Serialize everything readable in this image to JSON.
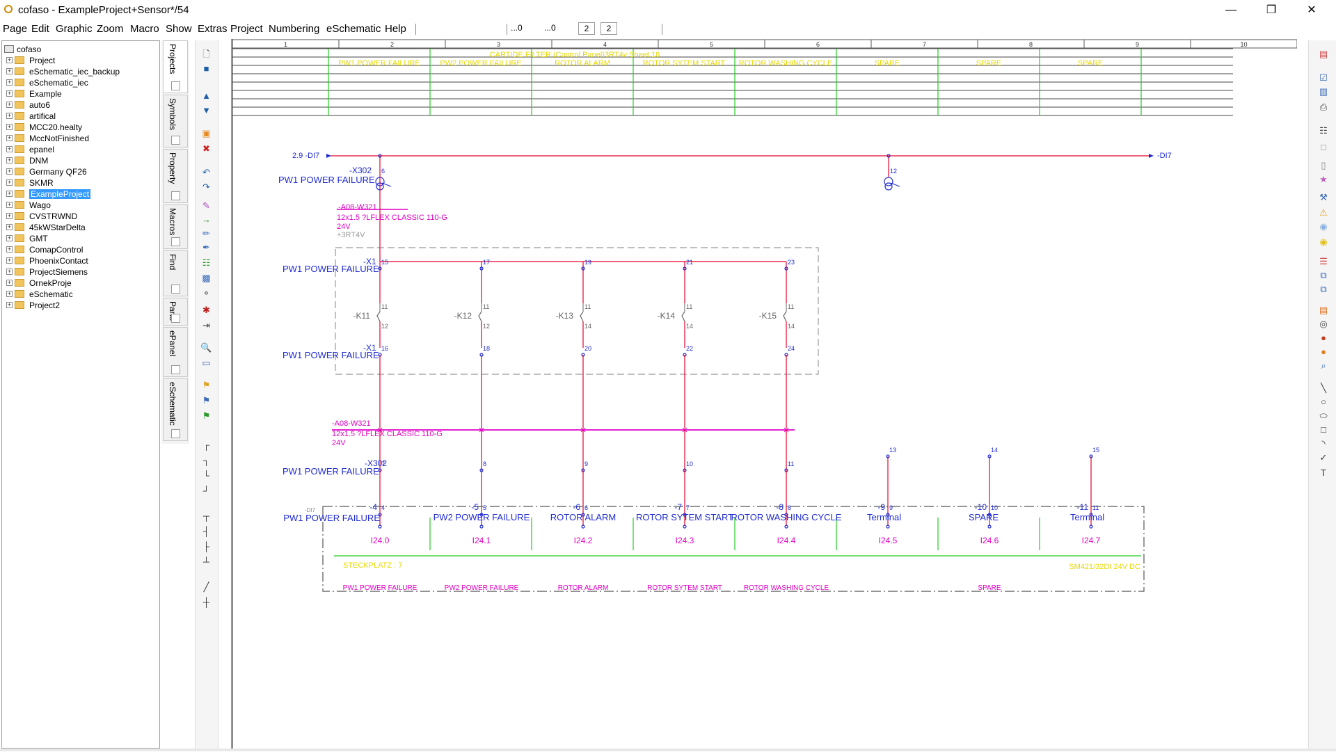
{
  "window": {
    "title": "cofaso - ExampleProject+Sensor*/54"
  },
  "menu": {
    "items": [
      "Page",
      "Edit",
      "Graphic",
      "Zoom",
      "Macro",
      "Show",
      "Extras",
      "Project",
      "Numbering",
      "eSchematic",
      "Help"
    ],
    "field_a": "...0",
    "field_b": "...0",
    "page_box_1": "2",
    "page_box_2": "2"
  },
  "tree": {
    "root": "cofaso",
    "items": [
      "Project",
      "eSchematic_iec_backup",
      "eSchematic_iec",
      "Example",
      "auto6",
      "artifical",
      "MCC20.healty",
      "MccNotFinished",
      "epanel",
      "DNM",
      "Germany QF26",
      "SKMR",
      "ExampleProject",
      "Wago",
      "CVSTRWND",
      "45kWStarDelta",
      "GMT",
      "ComapControl",
      "PhoenixContact",
      "ProjectSiemens",
      "OrnekProje",
      "eSchematic",
      "Project2"
    ],
    "selected": "ExampleProject"
  },
  "side_tabs": [
    "Projects",
    "Symbols",
    "Property",
    "Macros",
    "Find",
    "Parts",
    "ePanel",
    "eSchematic"
  ],
  "schematic": {
    "columns": [
      "1",
      "2",
      "3",
      "4",
      "5",
      "6",
      "7",
      "8",
      "9",
      "10"
    ],
    "header_title": "CARTIDE FILTER (Control Panel)3RT4v Sheet 18",
    "header_cells": [
      "PW1 POWER FAILURE",
      "PW2 POWER FAILURE",
      "ROTOR ALARM",
      "ROTOR SYTEM START",
      "ROTOR WASHING CYCLE",
      "SPARE",
      "SPARE",
      "SPARE"
    ],
    "bus_left": "2.9 -DI7",
    "bus_right": "-DI7",
    "x302_label": "-X302",
    "x302_top_terminals": [
      "6",
      "12"
    ],
    "pw1_label": "PW1 POWER FAILURE",
    "cable_1": {
      "ref": "-A08-W321",
      "type": "12x1.5 ?LFLEX CLASSIC 110-G",
      "voltage": "24V",
      "loc": "+3RT4V"
    },
    "x1_label": "-X1",
    "x1_top": [
      "15",
      "17",
      "19",
      "21",
      "23"
    ],
    "relays": [
      "-K11",
      "-K12",
      "-K13",
      "-K14",
      "-K15"
    ],
    "relay_top_pins": [
      "11",
      "11",
      "11",
      "11",
      "11"
    ],
    "relay_bottom_pins": [
      "12",
      "12",
      "14",
      "14",
      "14"
    ],
    "x1_bottom": [
      "16",
      "18",
      "20",
      "22",
      "24"
    ],
    "cable_2": {
      "ref": "-A08-W321",
      "type": "12x1.5 ?LFLEX CLASSIC 110-G",
      "voltage": "24V"
    },
    "x302_bottom": [
      "7",
      "8",
      "9",
      "10",
      "11",
      "13",
      "14",
      "15"
    ],
    "io_channels": [
      "-4",
      "-5",
      "-6",
      "-7",
      "-8",
      "-9",
      "-10",
      "-11"
    ],
    "io_pins": [
      "4",
      "5",
      "6",
      "7",
      "8",
      "9",
      "10",
      "11"
    ],
    "io_di_label": "-DI7",
    "io_names": [
      "PW1 POWER FAILURE",
      "PW2 POWER FAILURE",
      "ROTOR ALARM",
      "ROTOR SYTEM START",
      "ROTOR WASHING CYCLE",
      "Terminal",
      "SPARE",
      "Terminal"
    ],
    "io_addresses": [
      "I24.0",
      "I24.1",
      "I24.2",
      "I24.3",
      "I24.4",
      "I24.5",
      "I24.6",
      "I24.7"
    ],
    "slot_label": "STECKPLATZ : 7",
    "module_label": "SM421/32DI 24V DC",
    "footer_names": [
      "PW1 POWER FAILURE",
      "PW2 POWER FAILURE",
      "ROTOR ALARM",
      "ROTOR SYTEM START",
      "ROTOR WASHING CYCLE",
      "SPARE"
    ]
  },
  "colors": {
    "wire": "#e8002a",
    "terminal": "#1f2bd0",
    "cable": "#e000c8",
    "label_magenta": "#e000c8",
    "grid_green": "#22cc22",
    "header_yellow": "#e6d800",
    "relay_gray": "#666666"
  }
}
